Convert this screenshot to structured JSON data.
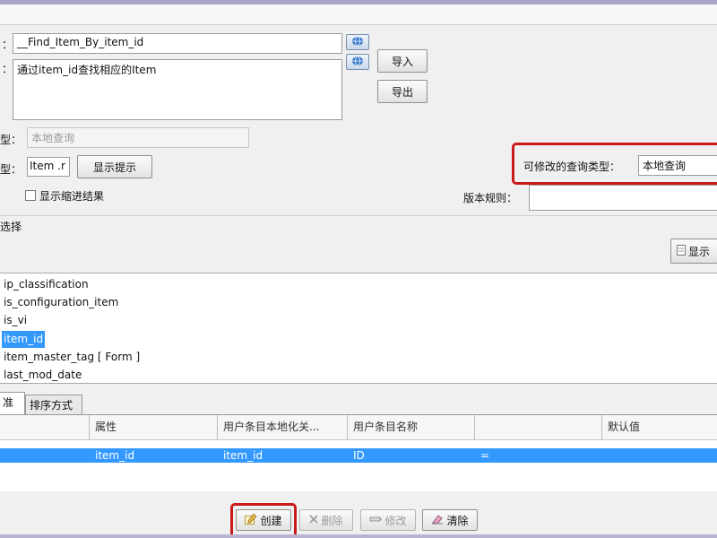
{
  "query": {
    "name_value": "__Find_Item_By_item_id",
    "description_value": "通过item_id查找相应的Item",
    "type_value": "本地查询",
    "class_value": "Item .r",
    "show_hint_label": "显示提示",
    "show_indent_label": "显示缩进结果",
    "label_type_suffix": "型：",
    "label_class_suffix": "型："
  },
  "buttons": {
    "import": "导入",
    "export": "导出",
    "show_right": "显示",
    "create": "创建",
    "delete": "删除",
    "modify": "修改",
    "clear": "清除"
  },
  "right_panel": {
    "modifiable_type_label": "可修改的查询类型：",
    "modifiable_type_value": "本地查询",
    "revision_rule_label": "版本规则："
  },
  "attr_section": {
    "title_fragment": "选择"
  },
  "attributes": [
    {
      "label": "ip_classification"
    },
    {
      "label": "is_configuration_item"
    },
    {
      "label": "is_vi"
    },
    {
      "label": "item_id"
    },
    {
      "label": "item_master_tag [ Form ]"
    },
    {
      "label": "last_mod_date"
    }
  ],
  "tabs": [
    {
      "label": "准则"
    },
    {
      "label": "排序方式"
    }
  ],
  "grid": {
    "headers": [
      "",
      "属性",
      "用户条目本地化关...",
      "用户条目名称",
      "",
      "默认值"
    ],
    "row": [
      "",
      "item_id",
      "item_id",
      "ID",
      "=",
      ""
    ]
  },
  "colors": {
    "highlight": "#cc1a1a",
    "selection": "#3399ff"
  }
}
